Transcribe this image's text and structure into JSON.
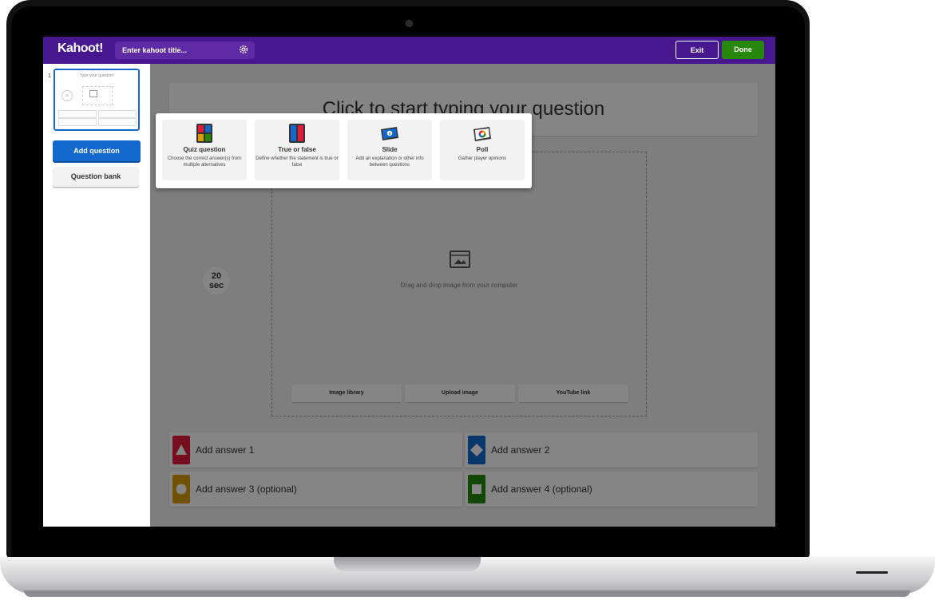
{
  "header": {
    "logo": "Kahoot!",
    "title_placeholder": "Enter kahoot title...",
    "exit_label": "Exit",
    "done_label": "Done",
    "colors": {
      "purple": "#46178f",
      "done_green": "#26890c"
    }
  },
  "sidebar": {
    "slides": [
      {
        "number": "1",
        "question_placeholder": "Type your question",
        "timer": "20"
      }
    ],
    "add_question_label": "Add question",
    "question_bank_label": "Question bank"
  },
  "editor": {
    "question_placeholder": "Click to start typing your question",
    "timer_value": "20",
    "timer_unit": "sec",
    "image_drop_text": "Drag and drop image from your computer",
    "media_buttons": [
      "Image library",
      "Upload image",
      "YouTube link"
    ],
    "answers": [
      {
        "label": "Add answer 1",
        "shape": "triangle",
        "color": "#e21b3c"
      },
      {
        "label": "Add answer 2",
        "shape": "diamond",
        "color": "#1368ce"
      },
      {
        "label": "Add answer 3 (optional)",
        "shape": "circle",
        "color": "#d89e00"
      },
      {
        "label": "Add answer 4 (optional)",
        "shape": "square",
        "color": "#26890c"
      }
    ]
  },
  "question_type_popup": {
    "types": [
      {
        "title": "Quiz question",
        "description": "Choose the correct answer(s) from multiple alternatives",
        "icon": "quiz-icon"
      },
      {
        "title": "True or false",
        "description": "Define whether the statement is true or false",
        "icon": "true-false-icon"
      },
      {
        "title": "Slide",
        "description": "Add an explanation or other info between questions",
        "icon": "slide-icon"
      },
      {
        "title": "Poll",
        "description": "Gather player opinions",
        "icon": "poll-icon"
      }
    ]
  }
}
